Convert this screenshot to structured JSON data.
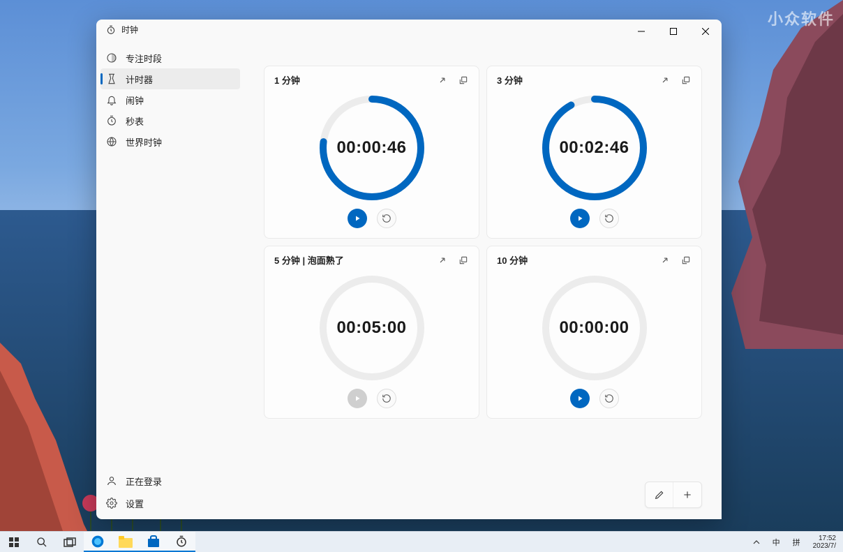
{
  "watermark": "小众软件",
  "window": {
    "title": "时钟",
    "nav": [
      {
        "icon": "focus",
        "label": "专注时段"
      },
      {
        "icon": "timer",
        "label": "计时器",
        "active": true
      },
      {
        "icon": "alarm",
        "label": "闹钟"
      },
      {
        "icon": "stopwatch",
        "label": "秒表"
      },
      {
        "icon": "world",
        "label": "世界时钟"
      }
    ],
    "bottom_nav": [
      {
        "icon": "user",
        "label": "正在登录"
      },
      {
        "icon": "settings",
        "label": "设置"
      }
    ]
  },
  "timers": [
    {
      "title": "1 分钟",
      "time": "00:00:46",
      "progress": 0.77,
      "active": true,
      "play_enabled": true
    },
    {
      "title": "3 分钟",
      "time": "00:02:46",
      "progress": 0.92,
      "active": true,
      "play_enabled": true
    },
    {
      "title": "5 分钟 | 泡面熟了",
      "time": "00:05:00",
      "progress": 0,
      "active": false,
      "play_enabled": false
    },
    {
      "title": "10 分钟",
      "time": "00:00:00",
      "progress": 0,
      "active": false,
      "play_enabled": true
    }
  ],
  "taskbar": {
    "tray": {
      "ime1": "中",
      "ime2": "拼",
      "time": "17:52",
      "date": "2023/7/"
    }
  }
}
